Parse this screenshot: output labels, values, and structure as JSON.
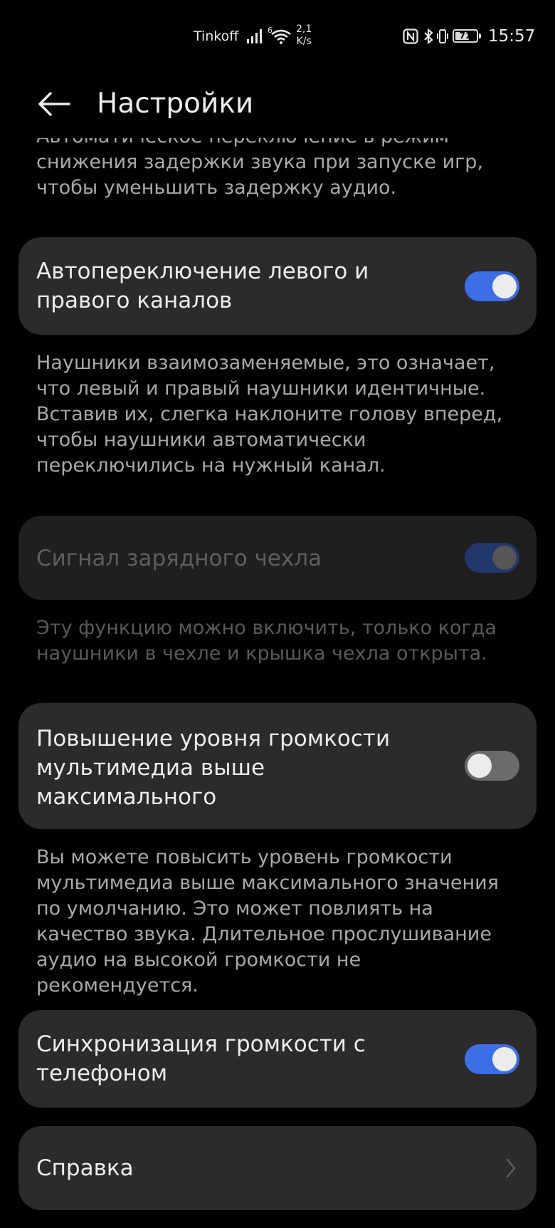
{
  "status_bar": {
    "carrier": "Tinkoff",
    "network_sup": "6",
    "speed_value": "2,1",
    "speed_unit": "K/s",
    "battery_level": "71",
    "battery_fraction": 0.71,
    "time": "15:57"
  },
  "header": {
    "title": "Настройки"
  },
  "settings": {
    "low_latency_desc_cut": "Автоматическое переключение в режим",
    "low_latency_desc_line2": "снижения задержки звука при запуске игр,",
    "low_latency_desc_line3": "чтобы уменьшить задержку аудио.",
    "auto_channel": {
      "label": "Автопереключение левого и правого каналов",
      "enabled": true,
      "description": "Наушники взаимозаменяемые, это означает, что левый и правый наушники идентичные. Вставив их, слегка наклоните голову вперед, чтобы наушники автоматически переключились на нужный канал."
    },
    "case_signal": {
      "label": "Сигнал зарядного чехла",
      "enabled": true,
      "disabled": true,
      "description": "Эту функцию можно включить, только когда наушники в чехле и крышка чехла открыта."
    },
    "volume_boost": {
      "label": "Повышение уровня громкости мультимедиа выше максимального",
      "enabled": false,
      "description": "Вы можете повысить уровень громкости мультимедиа выше максимального значения по умолчанию. Это может повлиять на качество звука. Длительное прослушивание аудио на высокой громкости не рекомендуется."
    },
    "volume_sync": {
      "label": "Синхронизация громкости с телефоном",
      "enabled": true
    },
    "help": {
      "label": "Справка"
    }
  },
  "colors": {
    "accent": "#3e6ee6",
    "card": "#2b2b2b",
    "background": "#000000"
  }
}
